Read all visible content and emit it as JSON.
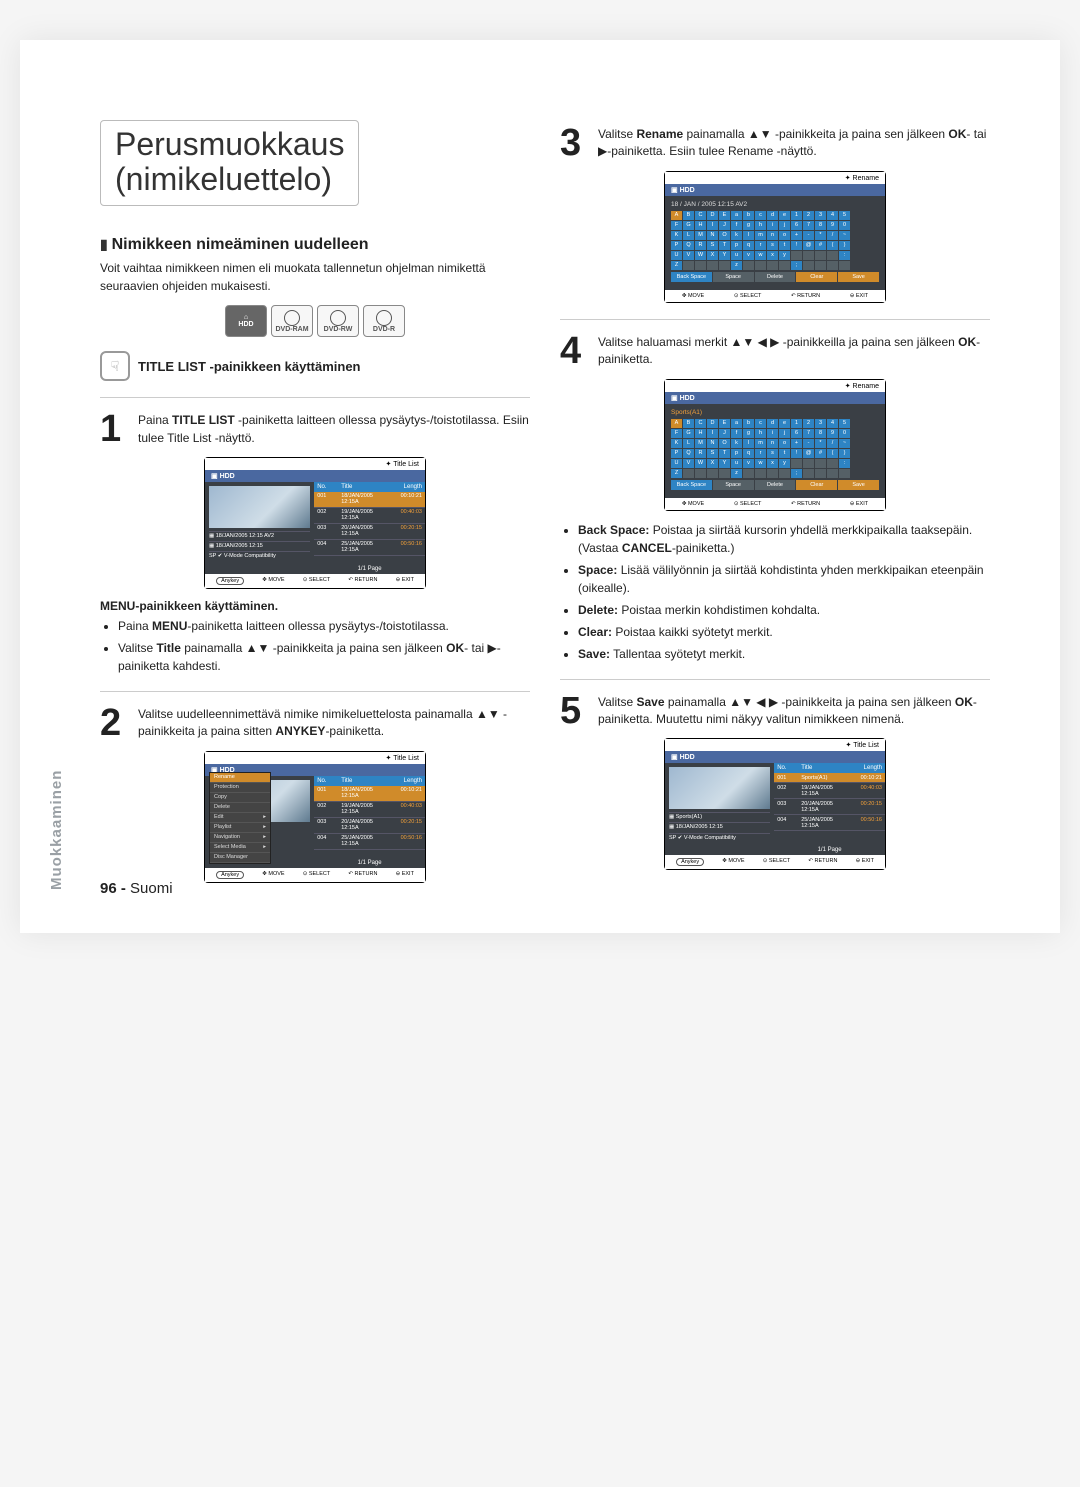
{
  "vertical_label": "Muokkaaminen",
  "title_line1": "Perusmuokkaus",
  "title_line2": "(nimikeluettelo)",
  "section_heading": "Nimikkeen nimeäminen uudelleen",
  "intro": "Voit vaihtaa nimikkeen nimen eli muokata tallennetun ohjelman nimikettä seuraavien ohjeiden mukaisesti.",
  "badges": [
    "HDD",
    "DVD-RAM",
    "DVD-RW",
    "DVD-R"
  ],
  "subhead": "TITLE LIST -painikkeen käyttäminen",
  "step1": "Paina <b>TITLE LIST</b> -painiketta laitteen ollessa pysäytys-/toistotilassa. Esiin tulee Title List -näyttö.",
  "sub_b": "MENU-painikkeen käyttäminen.",
  "bullets1": [
    "Paina <b>MENU</b>-painiketta laitteen ollessa pysäytys-/toistotilassa.",
    "Valitse <b>Title</b> painamalla ▲▼ -painikkeita ja paina sen jälkeen <b>OK</b>- tai ▶-painiketta kahdesti."
  ],
  "step2": "Valitse uudelleennimettävä nimike nimikeluettelosta painamalla ▲▼ -painikkeita ja paina sitten <b>ANYKEY</b>-painiketta.",
  "step3": "Valitse <b>Rename</b> painamalla ▲▼ -painikkeita ja paina sen jälkeen <b>OK</b>- tai ▶-painiketta. Esiin tulee Rename -näyttö.",
  "step4": "Valitse haluamasi merkit ▲▼ ◀ ▶ -painikkeilla ja paina sen jälkeen <b>OK</b>-painiketta.",
  "bullets4": [
    "<b>Back Space:</b> Poistaa ja siirtää kursorin yhdellä merkkipaikalla taaksepäin. (Vastaa <b>CANCEL</b>-painiketta.)",
    "<b>Space:</b> Lisää välilyönnin ja siirtää kohdistinta yhden merkkipaikan eteenpäin (oikealle).",
    "<b>Delete:</b> Poistaa merkin kohdistimen kohdalta.",
    "<b>Clear:</b> Poistaa kaikki syötetyt merkit.",
    "<b>Save:</b> Tallentaa syötetyt merkit."
  ],
  "step5": "Valitse <b>Save</b> painamalla ▲▼ ◀ ▶ -painikkeita ja paina sen jälkeen <b>OK</b>-painiketta. Muutettu nimi näkyy valitun nimikkeen nimenä.",
  "footer_pn": "96 -",
  "footer_lang": "Suomi",
  "ss": {
    "tl_header": "Title List",
    "rn_header": "Rename",
    "mode": "HDD",
    "cols": {
      "no": "No.",
      "title": "Title",
      "len": "Length"
    },
    "rows": [
      {
        "no": "001",
        "t": "18/JAN/2005 12:15A",
        "l": "00:10:21"
      },
      {
        "no": "002",
        "t": "19/JAN/2005 12:15A",
        "l": "00:40:03"
      },
      {
        "no": "003",
        "t": "20/JAN/2005 12:15A",
        "l": "00:20:15"
      },
      {
        "no": "004",
        "t": "25/JAN/2005 12:15A",
        "l": "00:50:16"
      }
    ],
    "rows_renamed_first": "Sports(A1)",
    "info_line1": "18/JAN/2005 12:15 AV2",
    "info_line2": "18/JAN/2005 12:15",
    "info_sp": "SP ✔ V-Mode Compatibility",
    "pager": "1/1 Page",
    "foot": {
      "any": "Anykey",
      "move": "MOVE",
      "select": "SELECT",
      "return": "RETURN",
      "exit": "EXIT"
    },
    "menu": [
      "Rename",
      "Protection",
      "Copy",
      "Delete",
      "Edit",
      "Playlist",
      "Navigation",
      "Select Media",
      "Disc Manager"
    ],
    "menu_arrow_items": [
      "Edit",
      "Playlist",
      "Navigation",
      "Select Media"
    ],
    "kb_title_plain": "18 / JAN / 2005 12:15 AV2",
    "kb_title_typed": "Sports(A1)",
    "kb_upper": [
      "A",
      "B",
      "C",
      "D",
      "E",
      "F",
      "G",
      "H",
      "I",
      "J",
      "K",
      "L",
      "M",
      "N",
      "O",
      "P",
      "Q",
      "R",
      "S",
      "T",
      "U",
      "V",
      "W",
      "X",
      "Y",
      "Z",
      "",
      "",
      "",
      ""
    ],
    "kb_lower": [
      "a",
      "b",
      "c",
      "d",
      "e",
      "f",
      "g",
      "h",
      "i",
      "j",
      "k",
      "l",
      "m",
      "n",
      "o",
      "p",
      "q",
      "r",
      "s",
      "t",
      "u",
      "v",
      "w",
      "x",
      "y",
      "z",
      "",
      "",
      "",
      ""
    ],
    "kb_num": [
      "1",
      "2",
      "3",
      "4",
      "5",
      "6",
      "7",
      "8",
      "9",
      "0",
      "+",
      "-",
      "*",
      "/",
      "~",
      "!",
      "@",
      "#",
      "(",
      ")",
      "",
      "",
      "",
      "",
      ":",
      ";",
      "",
      "",
      "",
      ""
    ],
    "kb_back": "Back Space",
    "kb_space": "Space",
    "kb_delete": "Delete",
    "kb_clear": "Clear",
    "kb_save": "Save"
  }
}
